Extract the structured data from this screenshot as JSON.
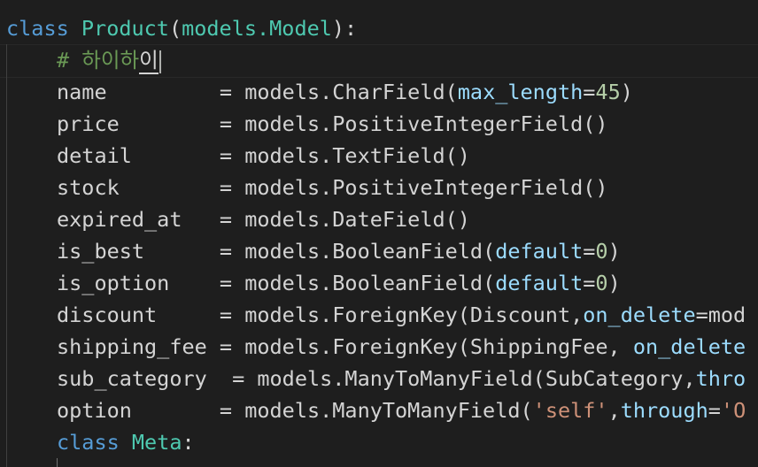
{
  "code": {
    "line1": {
      "kw": "class",
      "name": "Product",
      "open": "(",
      "base": "models.Model",
      "close": "):"
    },
    "comment": {
      "hash": "# ",
      "text": "하이하",
      "typing": "이"
    },
    "fields": [
      {
        "name": "name        ",
        "eq": " = ",
        "mod": "models.",
        "type": "CharField",
        "open": "(",
        "p1": "max_length",
        "eq1": "=",
        "v1": "45",
        "close": ")"
      },
      {
        "name": "price       ",
        "eq": " = ",
        "mod": "models.",
        "type": "PositiveIntegerField",
        "call": "()"
      },
      {
        "name": "detail      ",
        "eq": " = ",
        "mod": "models.",
        "type": "TextField",
        "call": "()"
      },
      {
        "name": "stock       ",
        "eq": " = ",
        "mod": "models.",
        "type": "PositiveIntegerField",
        "call": "()"
      },
      {
        "name": "expired_at  ",
        "eq": " = ",
        "mod": "models.",
        "type": "DateField",
        "call": "()"
      },
      {
        "name": "is_best     ",
        "eq": " = ",
        "mod": "models.",
        "type": "BooleanField",
        "open": "(",
        "p1": "default",
        "eq1": "=",
        "v1": "0",
        "close": ")"
      },
      {
        "name": "is_option   ",
        "eq": " = ",
        "mod": "models.",
        "type": "BooleanField",
        "open": "(",
        "p1": "default",
        "eq1": "=",
        "v1": "0",
        "close": ")"
      },
      {
        "name": "discount    ",
        "eq": " = ",
        "mod": "models.",
        "type": "ForeignKey",
        "open": "(",
        "arg": "Discount,",
        "p1": "on_delete",
        "eq1": "=",
        "rest": "mod"
      },
      {
        "name": "shipping_fee",
        "eq": " = ",
        "mod": "models.",
        "type": "ForeignKey",
        "open": "(",
        "arg": "ShippingFee, ",
        "p1": "on_delete"
      },
      {
        "name": "sub_category",
        "eq": "  = ",
        "mod": "models.",
        "type": "ManyToManyField",
        "open": "(",
        "arg": "SubCategory,",
        "p1": "thro"
      },
      {
        "name": "option      ",
        "eq": " = ",
        "mod": "models.",
        "type": "ManyToManyField",
        "open": "(",
        "str": "'self'",
        "comma": ",",
        "p1": "through",
        "eq1": "=",
        "str2": "'O"
      }
    ],
    "meta": {
      "kw": "class",
      "name": "Meta",
      "colon": ":"
    }
  },
  "colors": {
    "background": "#1e1e1e",
    "keyword": "#569cd6",
    "class_name": "#4ec9b0",
    "function": "#dcdcaa",
    "parameter": "#9cdcfe",
    "number": "#b5cea8",
    "string": "#ce9178",
    "comment": "#6a9955"
  }
}
